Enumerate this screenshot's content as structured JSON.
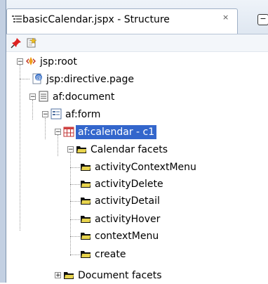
{
  "tab": {
    "title": "basicCalendar.jspx - Structure",
    "close_label": "×",
    "window_button_label": "−"
  },
  "toolbar": {
    "pin_icon": "pin-icon",
    "freeze_icon": "freeze-view-icon"
  },
  "tree": {
    "items": [
      {
        "label": "jsp:root",
        "icon": "jsp-root-icon",
        "expanded": true
      },
      {
        "label": "jsp:directive.page",
        "icon": "directive-icon"
      },
      {
        "label": "af:document",
        "icon": "document-icon",
        "expanded": true
      },
      {
        "label": "af:form",
        "icon": "form-icon",
        "expanded": true
      },
      {
        "label": "af:calendar - c1",
        "icon": "calendar-icon",
        "expanded": true,
        "selected": true
      },
      {
        "label": "Calendar facets",
        "icon": "folder-icon",
        "expanded": true
      },
      {
        "label": "activityContextMenu",
        "icon": "facet-icon"
      },
      {
        "label": "activityDelete",
        "icon": "facet-icon"
      },
      {
        "label": "activityDetail",
        "icon": "facet-icon"
      },
      {
        "label": "activityHover",
        "icon": "facet-icon"
      },
      {
        "label": "contextMenu",
        "icon": "facet-icon"
      },
      {
        "label": "create",
        "icon": "facet-icon"
      },
      {
        "label": "Document facets",
        "icon": "folder-icon",
        "expanded": false
      }
    ]
  }
}
